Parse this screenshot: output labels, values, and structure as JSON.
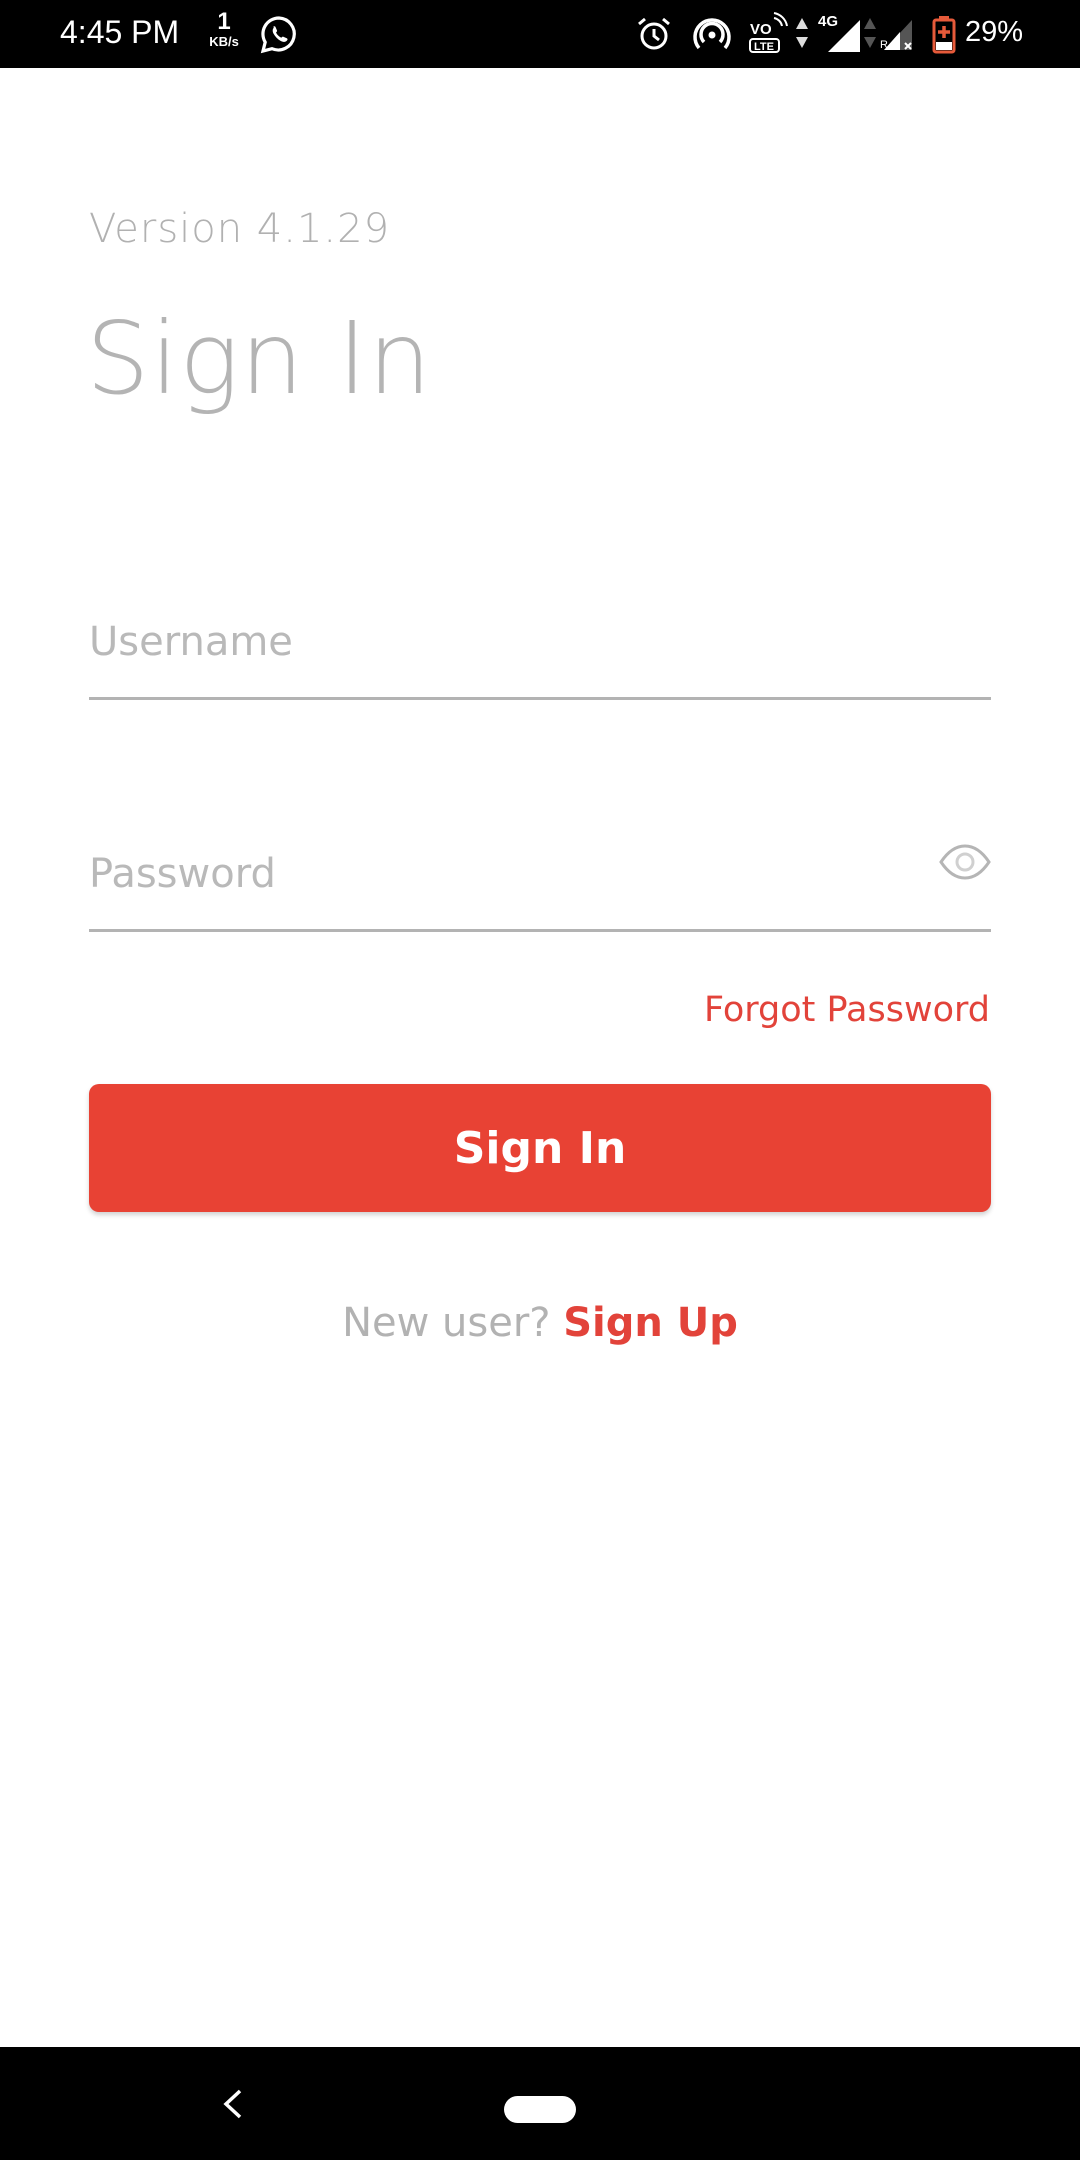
{
  "status_bar": {
    "time": "4:45 PM",
    "net_speed_value": "1",
    "net_speed_unit": "KB/s",
    "icons": [
      "whatsapp-icon",
      "alarm-icon",
      "hotspot-icon",
      "volte-icon",
      "data-arrows-icon",
      "signal-4g-icon",
      "signal-roaming-icon",
      "battery-charging-icon"
    ],
    "network_type": "4G",
    "volte_label_top": "VO",
    "volte_label_bottom": "LTE",
    "roaming_label": "R",
    "battery_percent": "29%",
    "battery_level": 0.29
  },
  "app": {
    "version": "Version 4.1.29",
    "title": "Sign In",
    "username": {
      "placeholder": "Username",
      "value": ""
    },
    "password": {
      "placeholder": "Password",
      "value": "",
      "toggle_icon": "eye-icon"
    },
    "forgot_password": "Forgot Password",
    "sign_in_button": "Sign In",
    "signup_prompt": "New user?",
    "signup_link": "Sign Up"
  },
  "colors": {
    "accent": "#e84234",
    "link": "#e2433a",
    "muted_text": "#b2b2b2",
    "underline": "#b3b3b3"
  },
  "nav_bar": {
    "back_icon": "back-chevron-icon",
    "home_icon": "home-pill-icon"
  }
}
